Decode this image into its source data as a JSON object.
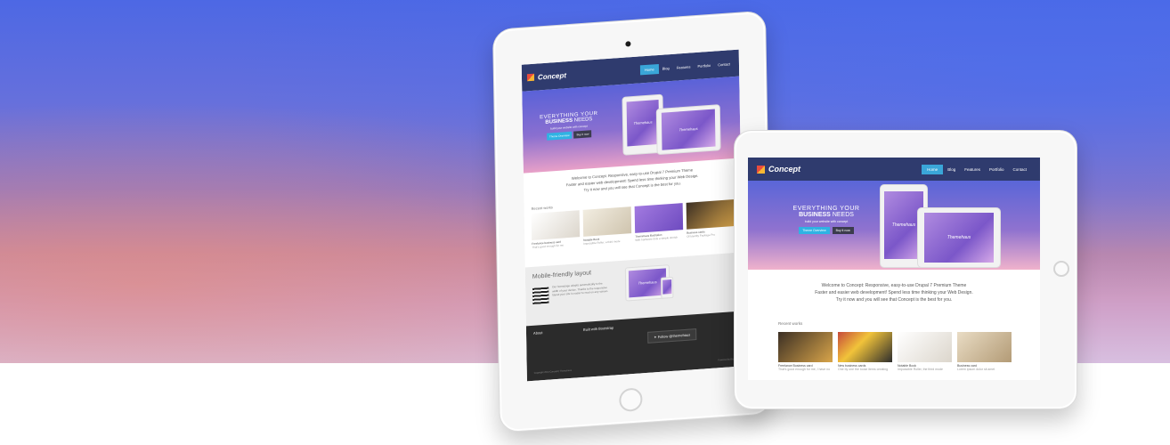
{
  "brand": {
    "name": "Concept"
  },
  "nav": {
    "items": [
      "Home",
      "Blog",
      "Features",
      "Portfolio",
      "Contact"
    ]
  },
  "hero": {
    "line1": "EVERYTHING YOUR",
    "line2_bold": "BUSINESS",
    "line2_rest": "NEEDS",
    "tagline": "build your website with concept",
    "btn_primary": "Theme Overview",
    "btn_secondary": "Buy it now",
    "mockup_label": "Themehaus"
  },
  "welcome": {
    "line1": "Welcome to Concept: Responsive, easy-to-use Drupal 7 Premium Theme",
    "line2": "Faster and easier web development! Spend less time thinking your Web Design.",
    "line3": "Try it now and you will see that Concept is the best for you."
  },
  "recent": {
    "title": "Recent works",
    "right_items": [
      {
        "cap": "Freelance Business card",
        "sub": "That's good enough for me, I have no"
      },
      {
        "cap": "New business cards",
        "sub": "One by one the loose items creating"
      },
      {
        "cap": "Notable Book",
        "sub": "Impossible Roller, the third mode"
      },
      {
        "cap": "Business card",
        "sub": "Lorem ipsum dolor sit amet"
      }
    ],
    "left_items": [
      {
        "cap": "Freelance business card",
        "sub": "That's good enough for me"
      },
      {
        "cap": "Notable Book",
        "sub": "Impossible Roller, a third mode"
      },
      {
        "cap": "Themehaus illustration",
        "sub": "With hardware dots a simple stretch"
      },
      {
        "cap": "Business cards",
        "sub": "Of Identity Package Pro"
      }
    ]
  },
  "mobile": {
    "title": "Mobile-friendly layout",
    "text": "Our homepage adapts automatically to the width of your device. Thanks to the responsive layout your site is easier to read on any screen."
  },
  "footer": {
    "col1_title": "About",
    "col2_title": "Built with Bootstrap",
    "follow_label": "Follow @themehaus",
    "copyright": "Copyright 2013 Concept | Themehaus",
    "powered": "Powered by Drupal"
  }
}
